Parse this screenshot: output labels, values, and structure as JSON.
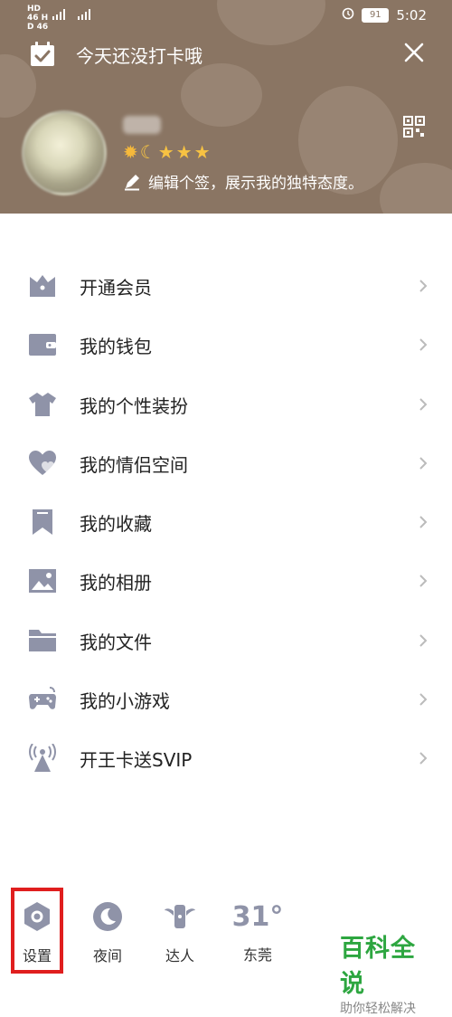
{
  "status_bar": {
    "network": "HD 46 HD 46",
    "battery": "91",
    "time": "5:02"
  },
  "header": {
    "checkin_text": "今天还没打卡哦",
    "signature": "编辑个签，展示我的独特态度。"
  },
  "menu": {
    "items": [
      {
        "label": "开通会员",
        "icon": "vip-icon"
      },
      {
        "label": "我的钱包",
        "icon": "wallet-icon"
      },
      {
        "label": "我的个性装扮",
        "icon": "shirt-icon"
      },
      {
        "label": "我的情侣空间",
        "icon": "hearts-icon"
      },
      {
        "label": "我的收藏",
        "icon": "bookmark-icon"
      },
      {
        "label": "我的相册",
        "icon": "photo-icon"
      },
      {
        "label": "我的文件",
        "icon": "folder-icon"
      },
      {
        "label": "我的小游戏",
        "icon": "gamepad-icon"
      },
      {
        "label": "开王卡送SVIP",
        "icon": "broadcast-icon"
      }
    ]
  },
  "bottom_bar": {
    "settings_label": "设置",
    "night_label": "夜间",
    "expert_label": "达人",
    "weather_temp": "31°",
    "weather_city": "东莞"
  },
  "watermark": {
    "title": "百科全说",
    "subtitle": "助你轻松解决"
  },
  "colors": {
    "header_bg": "#8a7563",
    "icon_color": "#8f93a8",
    "highlight_box": "#e01e1e",
    "watermark_green": "#2da640"
  }
}
